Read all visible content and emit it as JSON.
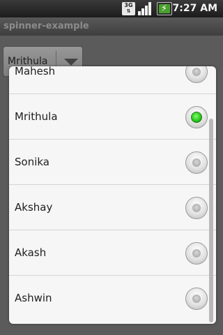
{
  "status_bar": {
    "network_label": "3G",
    "time": "7:27 AM",
    "network_icon": "3g-data-icon",
    "signal_icon": "signal-strength-icon",
    "battery_icon": "battery-charging-icon"
  },
  "app": {
    "title": "spinner-example"
  },
  "spinner": {
    "selected_value": "Mrithula"
  },
  "dialog": {
    "options": [
      {
        "label": "Mahesh",
        "checked": false
      },
      {
        "label": "Mrithula",
        "checked": true
      },
      {
        "label": "Sonika",
        "checked": false
      },
      {
        "label": "Akshay",
        "checked": false
      },
      {
        "label": "Akash",
        "checked": false
      },
      {
        "label": "Ashwin",
        "checked": false
      }
    ]
  },
  "colors": {
    "radio_checked": "#18b80c",
    "dialog_bg": "#f6f6f6",
    "status_bar_bg": "#1c1c1c"
  }
}
